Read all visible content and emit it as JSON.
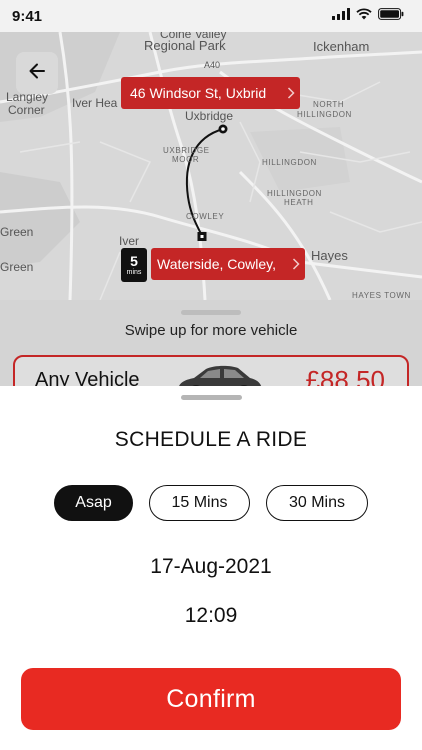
{
  "status_bar": {
    "time": "9:41"
  },
  "map": {
    "labels": {
      "colne_valley": "Colne Valley",
      "regional_park": "Regional Park",
      "ickenham": "Ickenham",
      "a40": "A40",
      "langley": "Langley",
      "corner": "Corner",
      "iver_hea": "Iver Hea",
      "uxbridge": "Uxbridge",
      "north": "NORTH",
      "hillingdon_upper": "HILLINGDON",
      "uxbridge_moor_1": "UXBRIDGE",
      "uxbridge_moor_2": "MOOR",
      "hillingdon_mid": "HILLINGDON",
      "hillingdon_heath_1": "HILLINGDON",
      "hillingdon_heath_2": "HEATH",
      "cowley": "COWLEY",
      "green_1": "Green",
      "iver": "Iver",
      "green_2": "Green",
      "hayes": "Hayes",
      "hayes_town": "HAYES TOWN"
    },
    "pickup_address": "46 Windsor St, Uxbrid",
    "dropoff_address": "Waterside, Cowley,",
    "eta_value": "5",
    "eta_unit": "mins"
  },
  "vehicle_panel": {
    "swipe_hint": "Swipe up for more vehicle",
    "vehicle_name": "Any Vehicle",
    "price": "£88.50"
  },
  "schedule": {
    "title": "SCHEDULE A RIDE",
    "options": [
      "Asap",
      "15 Mins",
      "30 Mins"
    ],
    "selected_option": "Asap",
    "date": "17-Aug-2021",
    "time": "12:09",
    "confirm_label": "Confirm"
  },
  "colors": {
    "accent": "#e82a22",
    "pill_red": "#c42626",
    "chip_selected": "#111111"
  },
  "icons": [
    "back-arrow-icon",
    "chevron-right-icon",
    "signal-icon",
    "wifi-icon",
    "battery-icon",
    "car-icon"
  ]
}
